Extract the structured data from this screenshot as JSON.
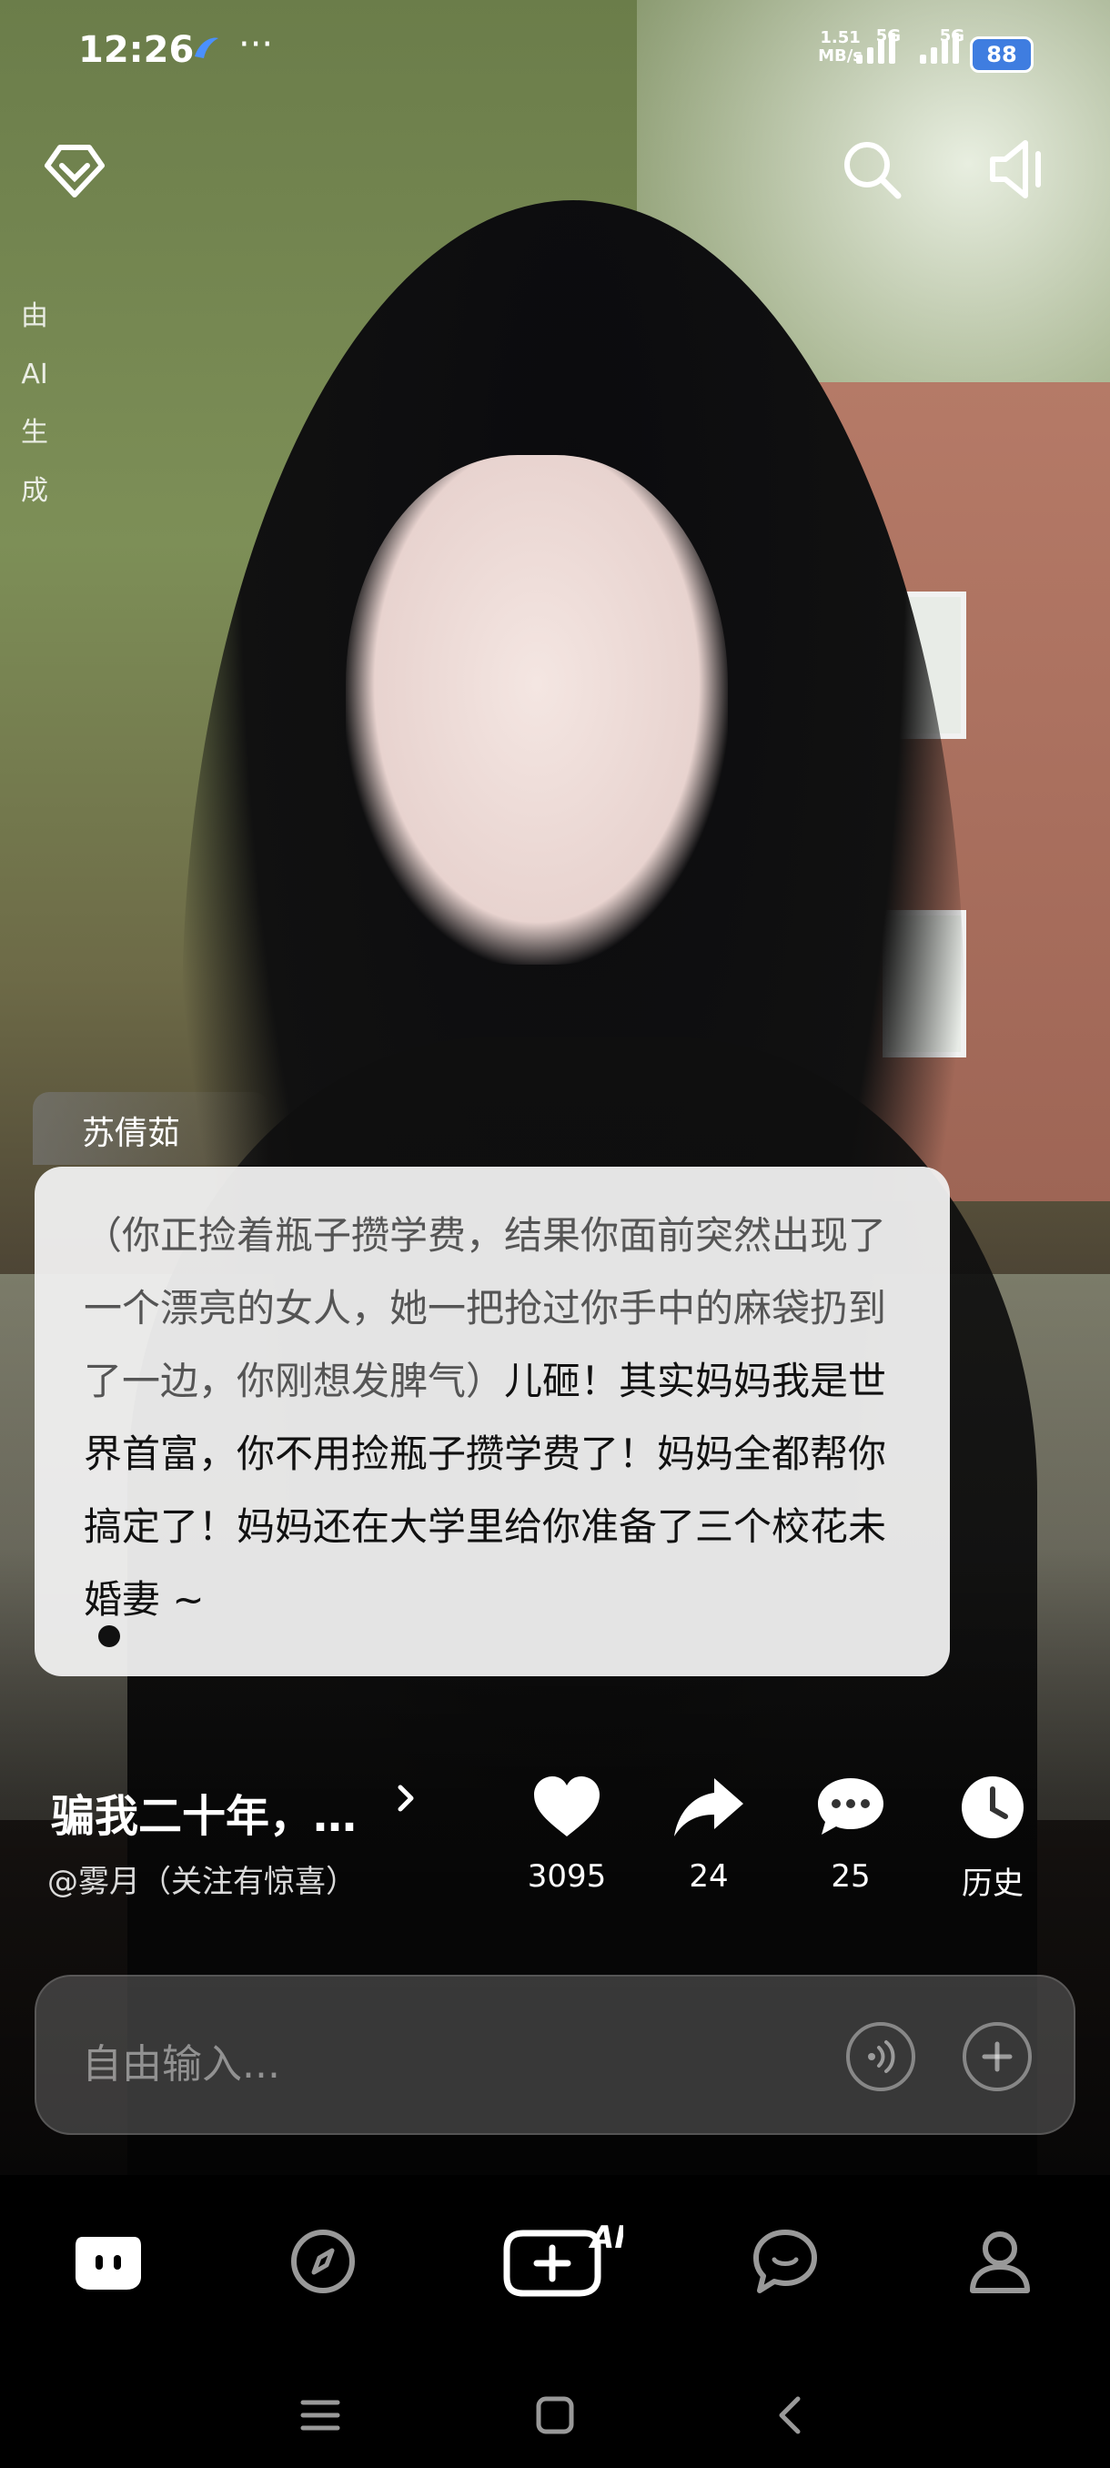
{
  "status_bar": {
    "time": "12:26",
    "dots": "···",
    "net_speed": "1.51",
    "net_unit": "MB/s",
    "sim1": "5G",
    "sim2": "5G",
    "battery": "88"
  },
  "ai_label": [
    "由",
    "AI",
    "生",
    "成"
  ],
  "character": {
    "name": "苏倩茹",
    "narration": "（你正捡着瓶子攒学费，结果你面前突然出现了一个漂亮的女人，她一把抢过你手中的麻袋扔到了一边，你刚想发脾气）",
    "speech": "儿砸！其实妈妈我是世界首富，你不用捡瓶子攒学费了！妈妈全都帮你搞定了！妈妈还在大学里给你准备了三个校花未婚妻 ~"
  },
  "story": {
    "title": "骗我二十年，…",
    "author": "@雾月（关注有惊喜）"
  },
  "actions": {
    "likes": "3095",
    "shares": "24",
    "comments": "25",
    "history": "历史"
  },
  "input": {
    "placeholder": "自由输入..."
  },
  "bottom_nav": {
    "create_label": "AI"
  }
}
